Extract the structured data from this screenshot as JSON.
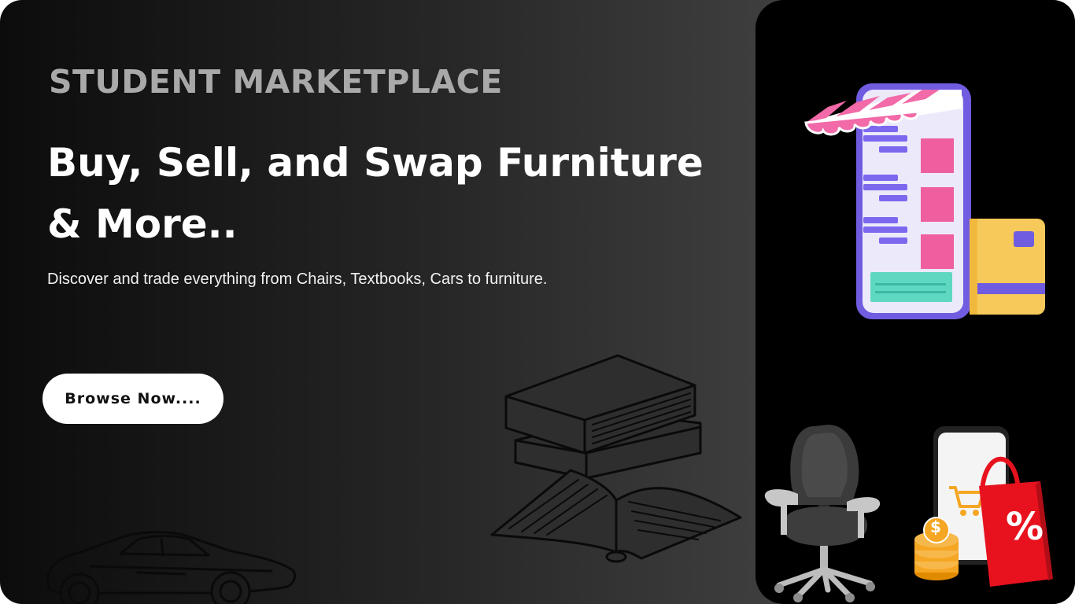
{
  "hero": {
    "eyebrow": "STUDENT MARKETPLACE",
    "headline_line1": "Buy, Sell, and Swap Furniture",
    "headline_line2": "& More..",
    "subtitle": "Discover and trade everything from Chairs, Textbooks, Cars to furniture.",
    "browse_label": "Browse Now...."
  },
  "illustrations": {
    "shop_phone": "storefront-phone-icon",
    "card": "credit-card-icon",
    "books": "books-sketch-icon",
    "car": "car-sketch-icon",
    "chair": "office-chair-icon",
    "shopping": "shopping-phone-bag-icon",
    "coins": "coins-icon",
    "discount_symbol": "%",
    "coin_symbol": "$"
  },
  "colors": {
    "accent_purple": "#6f5ce0",
    "accent_pink": "#f06aa8",
    "accent_teal": "#5fd8c2",
    "card_yellow": "#f6c95a",
    "bag_red": "#e8121e",
    "coin_orange": "#f5a623"
  }
}
